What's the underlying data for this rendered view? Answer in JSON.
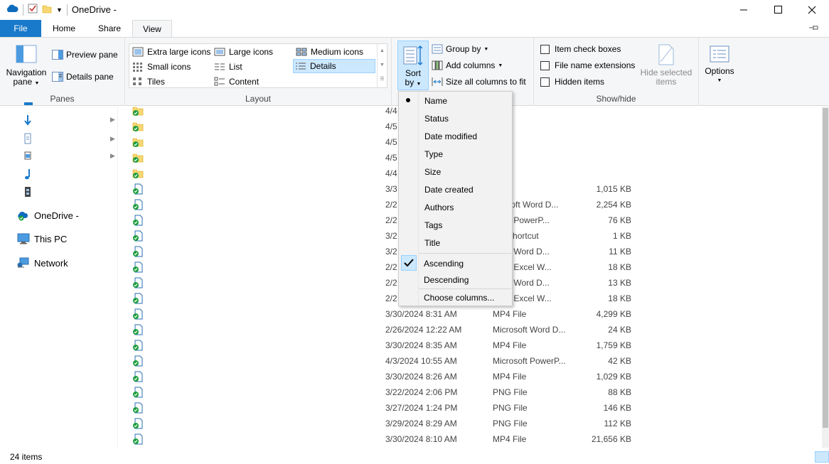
{
  "window": {
    "title": "OneDrive -"
  },
  "tabs": [
    {
      "label": "File"
    },
    {
      "label": "Home"
    },
    {
      "label": "Share"
    },
    {
      "label": "View"
    }
  ],
  "ribbon": {
    "panes": {
      "label": "Panes",
      "navigation_pane": "Navigation",
      "navigation_pane2": "pane",
      "preview_pane": "Preview pane",
      "details_pane": "Details pane"
    },
    "layout": {
      "label": "Layout",
      "items": [
        "Extra large icons",
        "Large icons",
        "Medium icons",
        "Small icons",
        "List",
        "Details",
        "Tiles",
        "Content"
      ],
      "selected": "Details"
    },
    "current_view": {
      "sort_by": "Sort",
      "sort_by2": "by",
      "group_by": "Group by",
      "add_columns": "Add columns",
      "size_all": "Size all columns to fit"
    },
    "show_hide": {
      "label": "Show/hide",
      "item_check_boxes": "Item check boxes",
      "file_name_extensions": "File name extensions",
      "hidden_items": "Hidden items",
      "hide_selected": "Hide selected",
      "hide_selected2": "items"
    },
    "options": {
      "label": "Options"
    }
  },
  "sort_menu": {
    "fields": [
      "Name",
      "Status",
      "Date modified",
      "Type",
      "Size",
      "Date created",
      "Authors",
      "Tags",
      "Title"
    ],
    "selected_field": "Name",
    "ascending": "Ascending",
    "descending": "Descending",
    "choose_columns": "Choose columns..."
  },
  "nav": {
    "onedrive": "OneDrive -",
    "this_pc": "This PC",
    "network": "Network"
  },
  "files": [
    {
      "date": "4/4",
      "type": "older",
      "size": ""
    },
    {
      "date": "4/5",
      "type": "older",
      "size": ""
    },
    {
      "date": "4/5",
      "type": "older",
      "size": ""
    },
    {
      "date": "4/5",
      "type": "older",
      "size": ""
    },
    {
      "date": "4/4",
      "type": "older",
      "size": ""
    },
    {
      "date": "3/3",
      "type": "File",
      "size": "1,015 KB"
    },
    {
      "date": "2/2",
      "type": "icrosoft Word D...",
      "size": "2,254 KB"
    },
    {
      "date": "2/2",
      "type": "osoft PowerP...",
      "size": "76 KB"
    },
    {
      "date": "3/2",
      "type": "net Shortcut",
      "size": "1 KB"
    },
    {
      "date": "3/2",
      "type": "osoft Word D...",
      "size": "11 KB"
    },
    {
      "date": "2/2",
      "type": "osoft Excel W...",
      "size": "18 KB"
    },
    {
      "date": "2/2",
      "type": "osoft Word D...",
      "size": "13 KB"
    },
    {
      "date": "2/2",
      "type": "osoft Excel W...",
      "size": "18 KB"
    },
    {
      "date": "3/30/2024 8:31 AM",
      "type": "MP4 File",
      "size": "4,299 KB"
    },
    {
      "date": "2/26/2024 12:22 AM",
      "type": "Microsoft Word D...",
      "size": "24 KB"
    },
    {
      "date": "3/30/2024 8:35 AM",
      "type": "MP4 File",
      "size": "1,759 KB"
    },
    {
      "date": "4/3/2024 10:55 AM",
      "type": "Microsoft PowerP...",
      "size": "42 KB"
    },
    {
      "date": "3/30/2024 8:26 AM",
      "type": "MP4 File",
      "size": "1,029 KB"
    },
    {
      "date": "3/22/2024 2:06 PM",
      "type": "PNG File",
      "size": "88 KB"
    },
    {
      "date": "3/27/2024 1:24 PM",
      "type": "PNG File",
      "size": "146 KB"
    },
    {
      "date": "3/29/2024 8:29 AM",
      "type": "PNG File",
      "size": "112 KB"
    },
    {
      "date": "3/30/2024 8:10 AM",
      "type": "MP4 File",
      "size": "21,656 KB"
    }
  ],
  "status": {
    "items_count": "24 items"
  },
  "colors": {
    "accent": "#1979ca",
    "selection": "#cce8ff",
    "sync_green": "#1e9e3e"
  }
}
